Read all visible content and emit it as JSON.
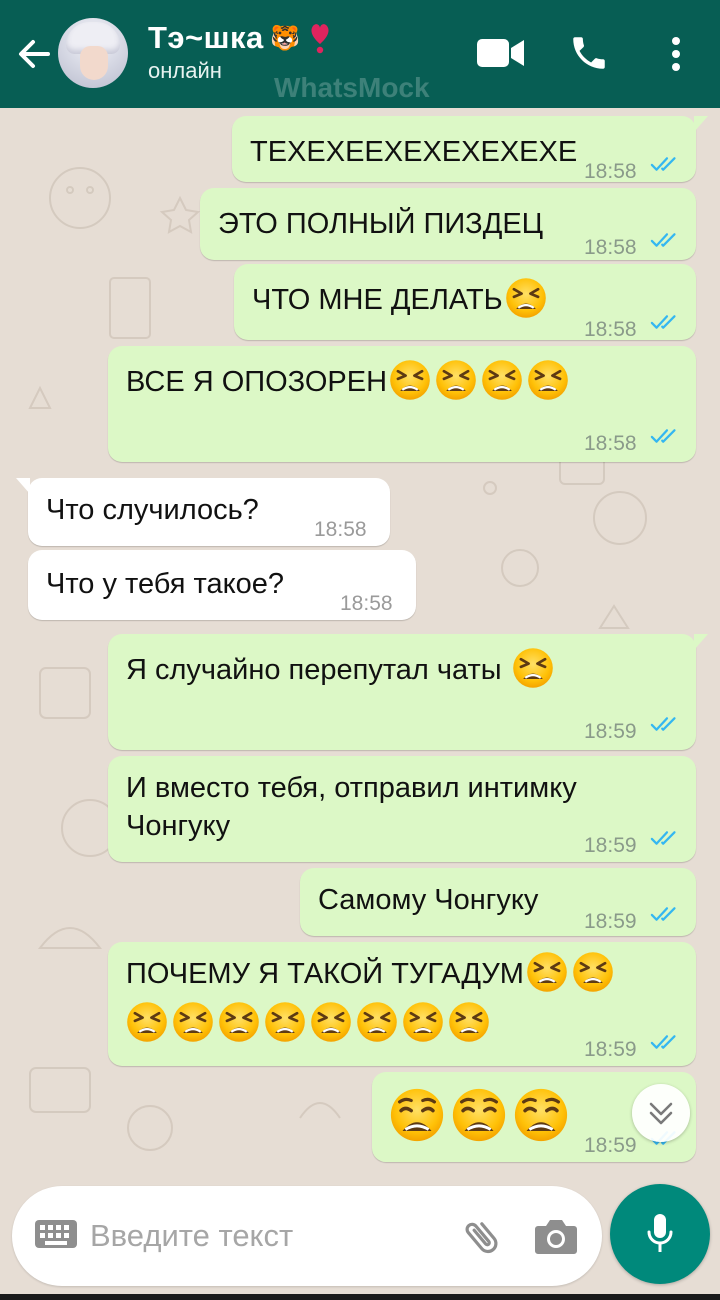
{
  "header": {
    "contact_name": "Тэ~шка",
    "name_emoji": "🐯",
    "status": "онлайн",
    "watermark": "WhatsMock",
    "bg_color": "#075e54"
  },
  "messages": [
    {
      "direction": "out",
      "text": "ТЕХЕХЕЕХЕХЕХЕХЕХЕ",
      "emoji_count": 0,
      "time": "18:58",
      "read": true
    },
    {
      "direction": "out",
      "text": "ЭТО ПОЛНЫЙ ПИЗДЕЦ",
      "emoji_count": 0,
      "time": "18:58",
      "read": true
    },
    {
      "direction": "out",
      "text": "ЧТО МНЕ ДЕЛАТЬ",
      "emoji": "tired-face",
      "emoji_count": 1,
      "time": "18:58",
      "read": true
    },
    {
      "direction": "out",
      "text": "ВСЕ Я ОПОЗОРЕН",
      "emoji": "tired-face",
      "emoji_count": 4,
      "time": "18:58",
      "read": true
    },
    {
      "direction": "in",
      "text": "Что случилось?",
      "time": "18:58"
    },
    {
      "direction": "in",
      "text": "Что у тебя такое?",
      "time": "18:58"
    },
    {
      "direction": "out",
      "text": "Я случайно перепутал чаты ",
      "emoji": "tired-face",
      "emoji_count": 1,
      "time": "18:59",
      "read": true
    },
    {
      "direction": "out",
      "text_lines": [
        "И вместо тебя, отправил интимку",
        "Чонгуку"
      ],
      "time": "18:59",
      "read": true
    },
    {
      "direction": "out",
      "text": "Самому Чонгуку",
      "time": "18:59",
      "read": true
    },
    {
      "direction": "out",
      "text": "ПОЧЕМУ Я ТАКОЙ ТУГАДУМ",
      "emoji": "tired-face",
      "emoji_count": 10,
      "time": "18:59",
      "read": true
    },
    {
      "direction": "out",
      "emoji": "weary-face",
      "emoji_count": 3,
      "time": "18:59",
      "read": true
    }
  ],
  "input": {
    "placeholder": "Введите текст"
  },
  "colors": {
    "outgoing_bubble": "#dcf8c6",
    "incoming_bubble": "#ffffff",
    "read_ticks": "#34b7f1",
    "accent": "#00897b"
  }
}
